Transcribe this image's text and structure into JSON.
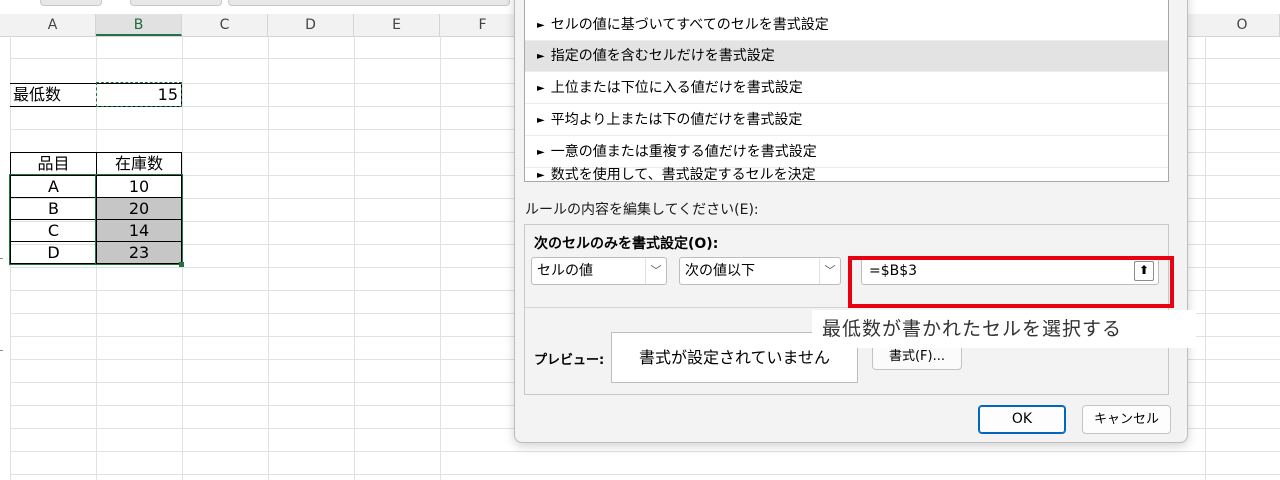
{
  "sheet": {
    "columns": [
      "A",
      "B",
      "C",
      "D",
      "E",
      "F",
      "O"
    ],
    "min_label": "最低数",
    "min_value": "15",
    "table_headers": [
      "品目",
      "在庫数"
    ],
    "rows": [
      {
        "item": "A",
        "qty": "10"
      },
      {
        "item": "B",
        "qty": "20"
      },
      {
        "item": "C",
        "qty": "14"
      },
      {
        "item": "D",
        "qty": "23"
      }
    ]
  },
  "dialog": {
    "rule_types": [
      "セルの値に基づいてすべてのセルを書式設定",
      "指定の値を含むセルだけを書式設定",
      "上位または下位に入る値だけを書式設定",
      "平均より上または下の値だけを書式設定",
      "一意の値または重複する値だけを書式設定",
      "数式を使用して、書式設定するセルを決定"
    ],
    "edit_label": "ルールの内容を編集してください(E):",
    "condition_label": "次のセルのみを書式設定(O):",
    "combo_1": "セルの値",
    "combo_2": "次の値以下",
    "formula_value": "=$B$3",
    "preview_label": "プレビュー:",
    "preview_text": "書式が設定されていません",
    "format_button": "書式(F)...",
    "ok_button": "OK",
    "cancel_button": "キャンセル"
  },
  "annotation": {
    "callout_text": "最低数が書かれたセルを選択する",
    "highlight_color": "#e60012"
  },
  "icons": {
    "rule_arrow": "►",
    "dropdown": "﹀",
    "collapse": "⬆"
  }
}
